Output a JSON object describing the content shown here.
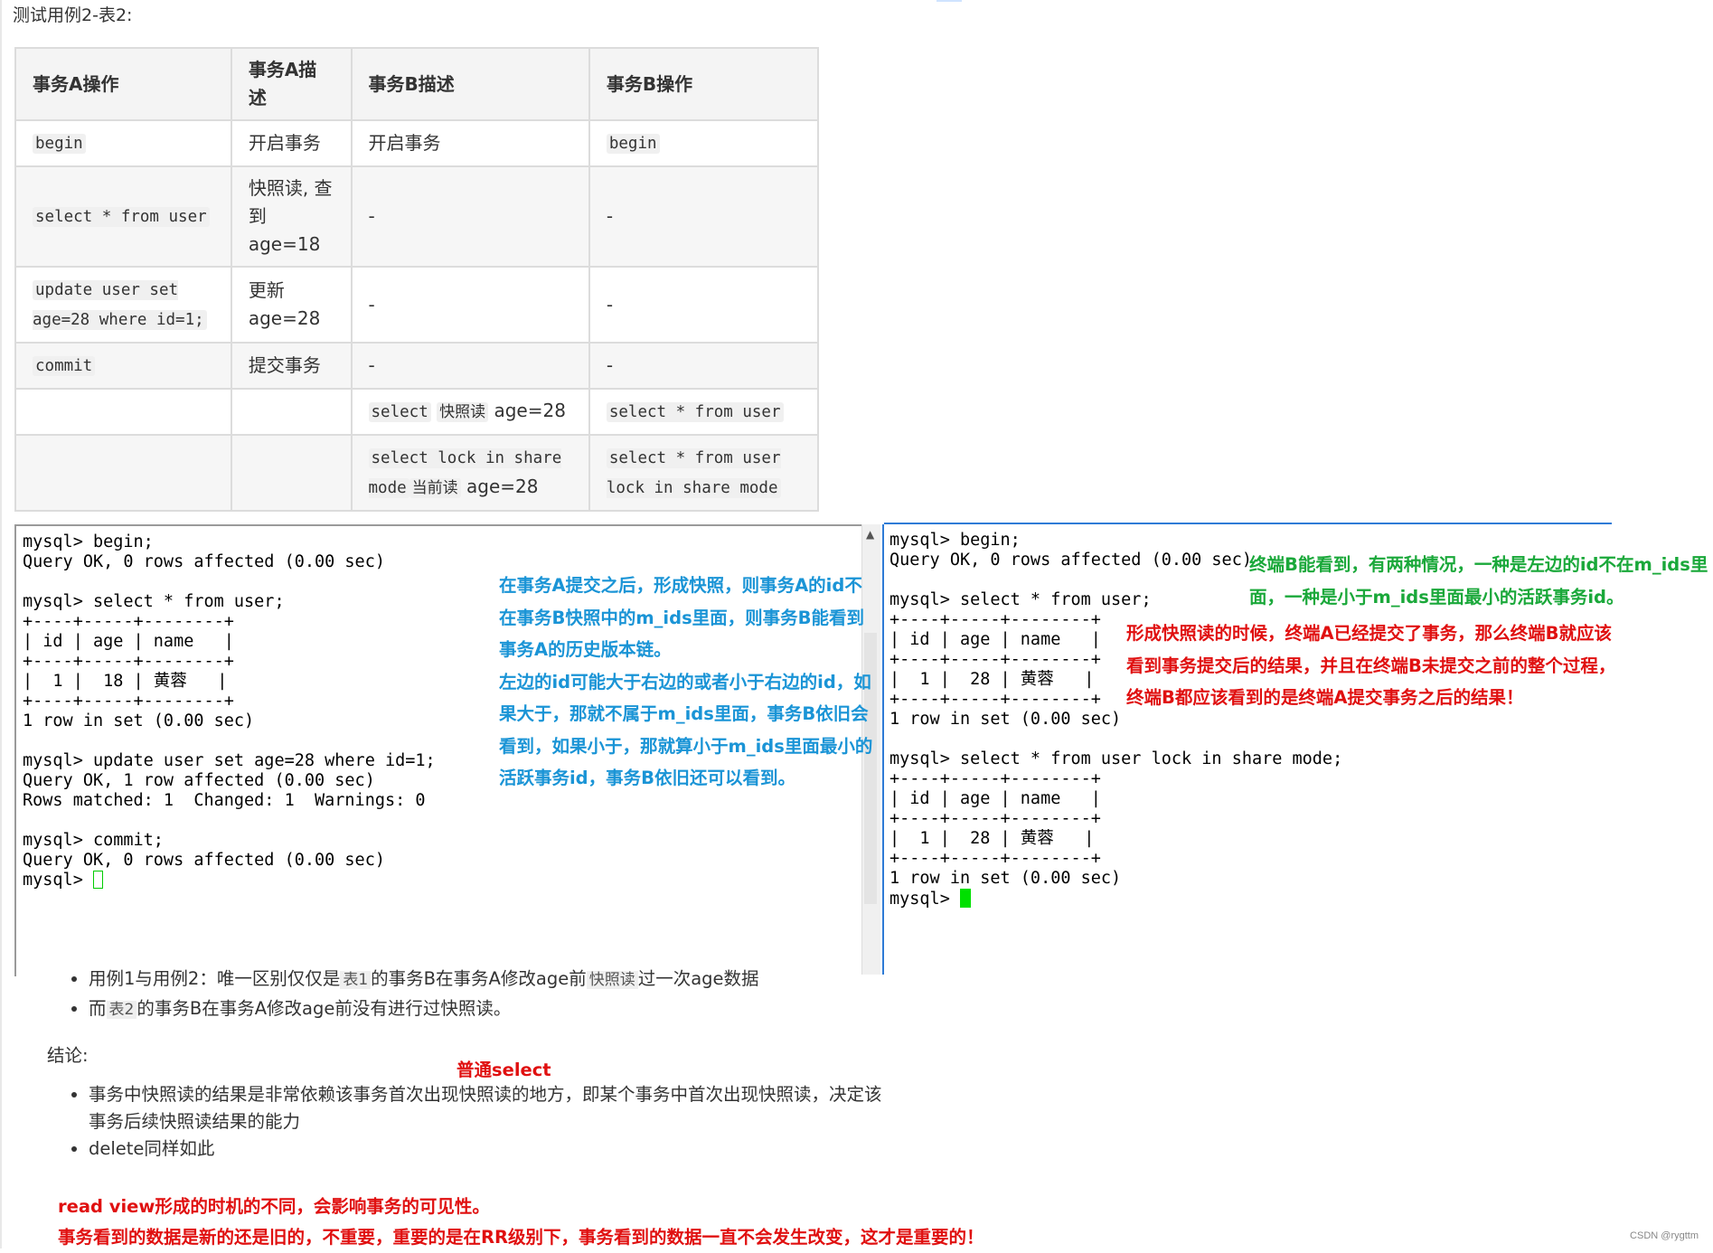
{
  "heading": "测试用例2-表2:",
  "table": {
    "headers": [
      "事务A操作",
      "事务A描述",
      "事务B描述",
      "事务B操作"
    ],
    "rows": [
      {
        "a_op": "begin",
        "a_desc": "开启事务",
        "b_desc": "开启事务",
        "b_op": "begin"
      },
      {
        "a_op": "select * from user",
        "a_desc": "快照读, 查到 age=18",
        "b_desc": "-",
        "b_op": "-"
      },
      {
        "a_op": "update user set age=28 where id=1;",
        "a_desc": "更新 age=28",
        "b_desc": "-",
        "b_op": "-"
      },
      {
        "a_op": "commit",
        "a_desc": "提交事务",
        "b_desc": "-",
        "b_op": "-"
      },
      {
        "a_op": "",
        "a_desc": "",
        "b_desc_code": "select",
        "b_desc_tag": "快照读",
        "b_desc_suffix": "age=28",
        "b_op": "select * from user"
      },
      {
        "a_op": "",
        "a_desc": "",
        "b_desc_code": "select lock in share mode",
        "b_desc_tag": "当前读",
        "b_desc_suffix": "age=28",
        "b_op": "select * from user lock in share mode"
      }
    ]
  },
  "terminal_a": {
    "lines": [
      "mysql> begin;",
      "Query OK, 0 rows affected (0.00 sec)",
      "",
      "mysql> select * from user;",
      "+----+-----+--------+",
      "| id | age | name   |",
      "+----+-----+--------+",
      "|  1 |  18 | 黄蓉   |",
      "+----+-----+--------+",
      "1 row in set (0.00 sec)",
      "",
      "mysql> update user set age=28 where id=1;",
      "Query OK, 1 row affected (0.00 sec)",
      "Rows matched: 1  Changed: 1  Warnings: 0",
      "",
      "mysql> commit;",
      "Query OK, 0 rows affected (0.00 sec)",
      ""
    ],
    "prompt": "mysql> "
  },
  "terminal_b": {
    "lines": [
      "mysql> begin;",
      "Query OK, 0 rows affected (0.00 sec)",
      "",
      "mysql> select * from user;",
      "+----+-----+--------+",
      "| id | age | name   |",
      "+----+-----+--------+",
      "|  1 |  28 | 黄蓉   |",
      "+----+-----+--------+",
      "1 row in set (0.00 sec)",
      "",
      "mysql> select * from user lock in share mode;",
      "+----+-----+--------+",
      "| id | age | name   |",
      "+----+-----+--------+",
      "|  1 |  28 | 黄蓉   |",
      "+----+-----+--------+",
      "1 row in set (0.00 sec)",
      ""
    ],
    "prompt": "mysql> "
  },
  "annotations": {
    "blue": [
      "在事务A提交之后，形成快照，则事务A的id不",
      "在事务B快照中的m_ids里面，则事务B能看到",
      "事务A的历史版本链。",
      "左边的id可能大于右边的或者小于右边的id，如",
      "果大于，那就不属于m_ids里面，事务B依旧会",
      "看到，如果小于，那就算小于m_ids里面最小的",
      "活跃事务id，事务B依旧还可以看到。"
    ],
    "green": [
      "终端B能看到，有两种情况，一种是左边的id不在m_ids里",
      "面，一种是小于m_ids里面最小的活跃事务id。"
    ],
    "red_right": [
      "形成快照读的时候，终端A已经提交了事务，那么终端B就应该",
      "看到事务提交后的结果，并且在终端B未提交之前的整个过程，",
      "终端B都应该看到的是终端A提交事务之后的结果！"
    ],
    "red_select": "普通select",
    "red_bottom": [
      "read view形成的时机的不同，会影响事务的可见性。",
      "事务看到的数据是新的还是旧的，不重要，重要的是在RR级别下，事务看到的数据一直不会发生改变，这才是重要的！"
    ]
  },
  "notes": {
    "item1_prefix": "用例1与用例2：唯一区别仅仅是",
    "item1_code1": "表1",
    "item1_mid": "的事务B在事务A修改age前",
    "item1_code2": "快照读",
    "item1_suffix": "过一次age数据",
    "item2_prefix": "而",
    "item2_code": "表2",
    "item2_suffix": "的事务B在事务A修改age前没有进行过快照读。"
  },
  "conclusion": {
    "label": "结论:",
    "items": [
      "事务中快照读的结果是非常依赖该事务首次出现快照读的地方，即某个事务中首次出现快照读，决定该事务后续快照读结果的能力",
      "delete同样如此"
    ]
  },
  "footer": "CSDN @rygttm"
}
